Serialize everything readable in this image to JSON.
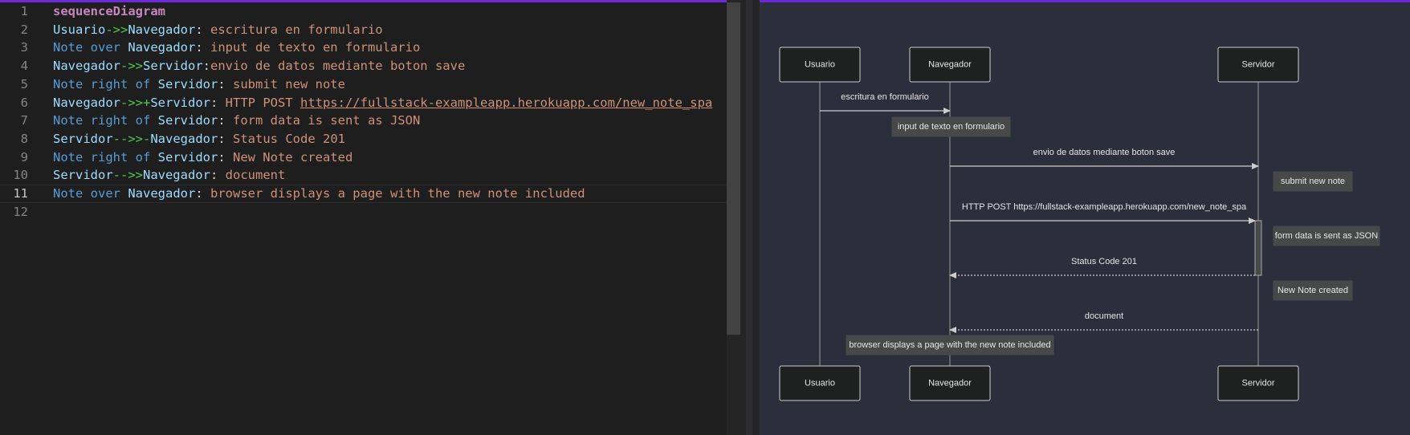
{
  "editor": {
    "lines": [
      {
        "num": "1",
        "tokens": [
          {
            "t": "sequenceDiagram",
            "c": "kw"
          }
        ]
      },
      {
        "num": "2",
        "tokens": [
          {
            "t": "Usuario",
            "c": "actor"
          },
          {
            "t": "->>",
            "c": "arrow"
          },
          {
            "t": "Navegador",
            "c": "actor"
          },
          {
            "t": ": ",
            "c": "plain"
          },
          {
            "t": "escritura en formulario",
            "c": "text"
          }
        ]
      },
      {
        "num": "3",
        "tokens": [
          {
            "t": "Note over ",
            "c": "note"
          },
          {
            "t": "Navegador",
            "c": "actor"
          },
          {
            "t": ": ",
            "c": "plain"
          },
          {
            "t": "input de texto en formulario",
            "c": "text"
          }
        ]
      },
      {
        "num": "4",
        "tokens": [
          {
            "t": "Navegador",
            "c": "actor"
          },
          {
            "t": "->>",
            "c": "arrow"
          },
          {
            "t": "Servidor",
            "c": "actor"
          },
          {
            "t": ":",
            "c": "plain"
          },
          {
            "t": "envio de datos mediante boton save",
            "c": "text"
          }
        ]
      },
      {
        "num": "5",
        "tokens": [
          {
            "t": "Note right of ",
            "c": "note"
          },
          {
            "t": "Servidor",
            "c": "actor"
          },
          {
            "t": ": ",
            "c": "plain"
          },
          {
            "t": "submit new note",
            "c": "text"
          }
        ]
      },
      {
        "num": "6",
        "tokens": [
          {
            "t": "Navegador",
            "c": "actor"
          },
          {
            "t": "->>+",
            "c": "arrow"
          },
          {
            "t": "Servidor",
            "c": "actor"
          },
          {
            "t": ": ",
            "c": "plain"
          },
          {
            "t": "HTTP POST ",
            "c": "text"
          },
          {
            "t": "https://fullstack-exampleapp.herokuapp.com/new_note_spa",
            "c": "link"
          }
        ]
      },
      {
        "num": "7",
        "tokens": [
          {
            "t": "Note right of ",
            "c": "note"
          },
          {
            "t": "Servidor",
            "c": "actor"
          },
          {
            "t": ": ",
            "c": "plain"
          },
          {
            "t": "form data is sent as JSON",
            "c": "text"
          }
        ]
      },
      {
        "num": "8",
        "tokens": [
          {
            "t": "Servidor",
            "c": "actor"
          },
          {
            "t": "-->>-",
            "c": "arrow"
          },
          {
            "t": "Navegador",
            "c": "actor"
          },
          {
            "t": ": ",
            "c": "plain"
          },
          {
            "t": "Status Code 201",
            "c": "text"
          }
        ]
      },
      {
        "num": "9",
        "tokens": [
          {
            "t": "Note right of ",
            "c": "note"
          },
          {
            "t": "Servidor",
            "c": "actor"
          },
          {
            "t": ": ",
            "c": "plain"
          },
          {
            "t": "New Note created",
            "c": "text"
          }
        ]
      },
      {
        "num": "10",
        "tokens": [
          {
            "t": "Servidor",
            "c": "actor"
          },
          {
            "t": "-->>",
            "c": "arrow"
          },
          {
            "t": "Navegador",
            "c": "actor"
          },
          {
            "t": ": ",
            "c": "plain"
          },
          {
            "t": "document",
            "c": "text"
          }
        ]
      },
      {
        "num": "11",
        "current": true,
        "tokens": [
          {
            "t": "Note over ",
            "c": "note"
          },
          {
            "t": "Navegador",
            "c": "actor"
          },
          {
            "t": ": ",
            "c": "plain"
          },
          {
            "t": "browser displays a page with the new note included",
            "c": "text"
          }
        ]
      },
      {
        "num": "12",
        "tokens": []
      }
    ]
  },
  "diagram": {
    "participants": [
      "Usuario",
      "Navegador",
      "Servidor"
    ],
    "messages": [
      {
        "from": "Usuario",
        "to": "Navegador",
        "text": "escritura en formulario",
        "style": "solid"
      },
      {
        "from": "Navegador",
        "to": "Servidor",
        "text": "envio de datos mediante boton save",
        "style": "solid"
      },
      {
        "from": "Navegador",
        "to": "Servidor",
        "text": "HTTP POST https://fullstack-exampleapp.herokuapp.com/new_note_spa",
        "style": "solid"
      },
      {
        "from": "Servidor",
        "to": "Navegador",
        "text": "Status Code 201",
        "style": "dotted"
      },
      {
        "from": "Servidor",
        "to": "Navegador",
        "text": "document",
        "style": "dotted"
      }
    ],
    "notes": [
      {
        "placement": "over",
        "actor": "Navegador",
        "text": "input de texto en formulario"
      },
      {
        "placement": "right of",
        "actor": "Servidor",
        "text": "submit new note"
      },
      {
        "placement": "right of",
        "actor": "Servidor",
        "text": "form data is sent as JSON"
      },
      {
        "placement": "right of",
        "actor": "Servidor",
        "text": "New Note created"
      },
      {
        "placement": "over",
        "actor": "Navegador",
        "text": "browser displays a page with the new note included"
      }
    ]
  },
  "colors": {
    "accent": "#6d28d9",
    "actor_box_fill": "#1f2020",
    "actor_box_stroke": "#cccccc",
    "note_fill": "#474949",
    "preview_bg": "#2b2e3b"
  }
}
